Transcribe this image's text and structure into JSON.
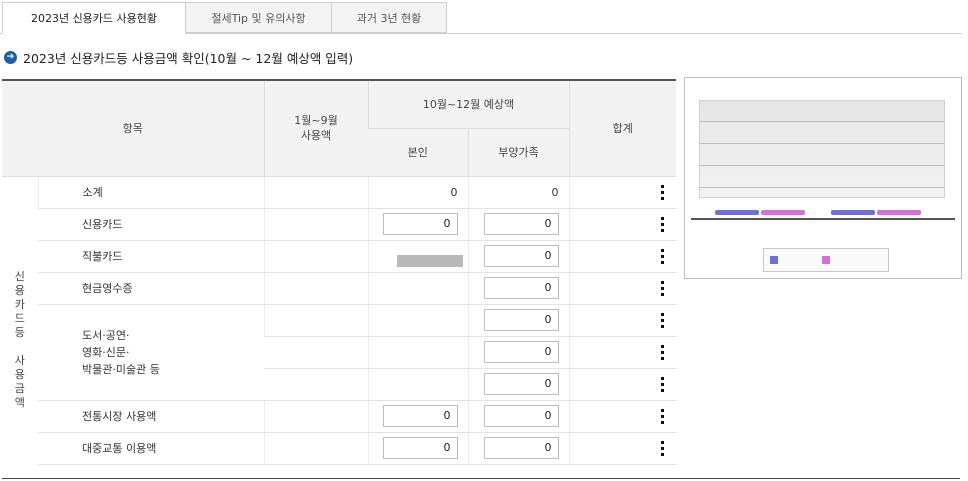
{
  "tabs": [
    {
      "label": "2023년 신용카드 사용현황",
      "active": true
    },
    {
      "label": "절세Tip 및 유의사항",
      "active": false
    },
    {
      "label": "과거 3년 현황",
      "active": false
    }
  ],
  "section": {
    "title": "2023년 신용카드등 사용금액 확인(10월 ~ 12월 예상액 입력)"
  },
  "table": {
    "headers": {
      "item": "항목",
      "jan_sep": "1월~9월\n사용액",
      "oct_dec": "10월~12월 예상액",
      "self": "본인",
      "dependents": "부양가족",
      "total": "합계"
    },
    "group_label": "신\n용\n카\n드\n등\n\n사\n용\n금\n액",
    "rows": [
      {
        "label": "소계",
        "self": "0",
        "dependents": "0"
      },
      {
        "label": "신용카드",
        "self": "0",
        "dependents": "0"
      },
      {
        "label": "직불카드",
        "self": "",
        "dependents": "0"
      },
      {
        "label": "현금영수증",
        "self": "",
        "dependents": "0"
      },
      {
        "label": "도서·공연·\n영화·신문·\n박물관·미술관 등",
        "self": "",
        "dependents": "0",
        "dependents2": "0",
        "dependents3": "0"
      },
      {
        "label": "전통시장 사용액",
        "self": "0",
        "dependents": "0"
      },
      {
        "label": "대중교통 이용액",
        "self": "0",
        "dependents": "0"
      }
    ]
  },
  "chart": {
    "colors": {
      "series1": "#6f6fd8",
      "series2": "#d86fd8"
    }
  }
}
